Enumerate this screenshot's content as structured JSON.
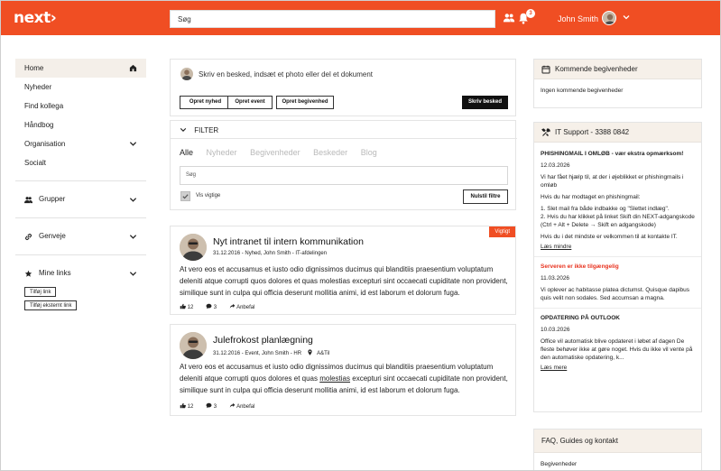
{
  "brand": {
    "logo": "next›",
    "accent": "#f04e23"
  },
  "topbar": {
    "search_placeholder": "Søg",
    "notification_count": "3",
    "user_name": "John Smith"
  },
  "sidebar": {
    "items": [
      {
        "label": "Home",
        "active": true,
        "icon": "home-icon"
      },
      {
        "label": "Nyheder"
      },
      {
        "label": "Find kollega"
      },
      {
        "label": "Håndbog"
      },
      {
        "label": "Organisation",
        "icon": "chevron-down-icon"
      },
      {
        "label": "Socialt"
      }
    ],
    "groups_label": "Grupper",
    "shortcuts_label": "Genveje",
    "my_links_label": "Mine links",
    "add_link": "Tilføj link",
    "add_external_link": "Tilføj eksternt link"
  },
  "composer": {
    "prompt": "Skriv en besked, indsæt et photo eller del et dokument",
    "btn_news": "Opret nyhed",
    "btn_event": "Opret event",
    "btn_occasion": "Opret begivenhed",
    "btn_write": "Skriv besked"
  },
  "filter": {
    "title": "FILTER",
    "tabs": [
      "Alle",
      "Nyheder",
      "Begivenheder",
      "Beskeder",
      "Blog"
    ],
    "search_placeholder": "Søg",
    "important_label": "Vis vigtige",
    "reset": "Nulstil filtre"
  },
  "posts": [
    {
      "title": "Nyt intranet til intern kommunikation",
      "meta": "31.12.2016 - Nyhed, John Smith - IT-afdelingen",
      "tag": "Vigtigt",
      "body_a": "At vero eos et accusamus et iusto odio dignissimos ducimus qui blanditiis praesentium voluptatum deleniti atque corrupti quos dolores et quas molestias excepturi sint occaecati cupiditate non provident, similique sunt in culpa qui officia deserunt mollitia animi, id est laborum et dolorum fuga.",
      "likes": "12",
      "comments": "3",
      "share": "Anbefal"
    },
    {
      "title": "Julefrokost planlægning",
      "meta_a": "31.12.2016 - Event, John Smith - HR",
      "meta_location": "A&Til",
      "body_pre": "At vero eos et accusamus et iusto odio dignissimos ducimus qui blanditiis praesentium voluptatum deleniti atque corrupti quos dolores et quas ",
      "body_link": "molestias",
      "body_post": " excepturi sint occaecati cupiditate non provident, similique sunt in culpa qui officia deserunt mollitia animi, id est laborum et dolorum fuga.",
      "likes": "12",
      "comments": "3",
      "share": "Anbefal"
    }
  ],
  "upcoming": {
    "title": "Kommende begivenheder",
    "empty": "Ingen kommende begivenheder"
  },
  "it_support": {
    "title": "IT Support - 3388 0842",
    "n1_title": "PHISHINGMAIL I OMLØB - vær ekstra opmærksom!",
    "n1_date": "12.03.2026",
    "n1_p1": "Vi har fået hjælp til, at der i øjeblikket er phishingmails i omløb",
    "n1_p2": "Hvis du har modtaget en phishingmail:",
    "n1_l1": "1. Slet mail fra både indbakke og \"Slettet indlæg\".",
    "n1_l2": "2. Hvis du har klikket på linket Skift din NEXT-adgangskode (Ctrl + Alt + Delete → Skift en adgangskode)",
    "n1_p3": "Hvis du i det mindste er velkommen til at kontakte IT.",
    "n1_more": "Læs mindre",
    "n2_title": "Serveren er ikke tilgængelig",
    "n2_date": "11.03.2026",
    "n2_body": "Vi oplever ac habitasse platea dictumst. Quisque dapibus quis velit non sodales. Sed accumsan a magna.",
    "n3_title": "OPDATERING PÅ OUTLOOK",
    "n3_date": "10.03.2026",
    "n3_body": "Office vil automatisk blive opdateret i løbet af dagen De fleste behøver ikke at gøre noget. Hvis du ikke vil vente på den automatiske opdatering, k...",
    "n3_more": "Læs mere"
  },
  "faq": {
    "title": "FAQ, Guides og kontakt",
    "item": "Begivenheder"
  }
}
